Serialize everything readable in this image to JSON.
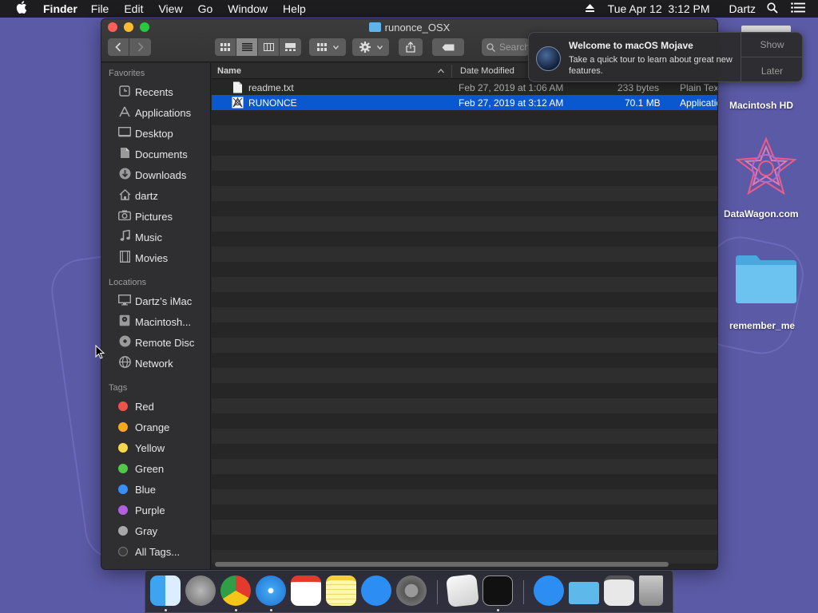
{
  "menubar": {
    "app_name": "Finder",
    "menus": [
      "File",
      "Edit",
      "View",
      "Go",
      "Window",
      "Help"
    ],
    "clock": "Tue Apr 12  3:12 PM",
    "user": "Dartz"
  },
  "window": {
    "title": "runonce_OSX",
    "search_placeholder": "Search"
  },
  "sidebar": {
    "favorites_header": "Favorites",
    "favorites": [
      {
        "label": "Recents",
        "icon": "clock-icon"
      },
      {
        "label": "Applications",
        "icon": "applications-icon"
      },
      {
        "label": "Desktop",
        "icon": "desktop-icon"
      },
      {
        "label": "Documents",
        "icon": "document-icon"
      },
      {
        "label": "Downloads",
        "icon": "download-icon"
      },
      {
        "label": "dartz",
        "icon": "home-icon"
      },
      {
        "label": "Pictures",
        "icon": "camera-icon"
      },
      {
        "label": "Music",
        "icon": "music-note-icon"
      },
      {
        "label": "Movies",
        "icon": "film-icon"
      }
    ],
    "locations_header": "Locations",
    "locations": [
      {
        "label": "Dartz’s iMac",
        "icon": "imac-icon"
      },
      {
        "label": "Macintosh...",
        "icon": "harddisk-icon"
      },
      {
        "label": "Remote Disc",
        "icon": "disc-icon"
      },
      {
        "label": "Network",
        "icon": "globe-icon"
      }
    ],
    "tags_header": "Tags",
    "tags": [
      {
        "label": "Red",
        "color": "#f0524c"
      },
      {
        "label": "Orange",
        "color": "#f5a623"
      },
      {
        "label": "Yellow",
        "color": "#f6d84a"
      },
      {
        "label": "Green",
        "color": "#52c84a"
      },
      {
        "label": "Blue",
        "color": "#3a8ef6"
      },
      {
        "label": "Purple",
        "color": "#b45fe0"
      },
      {
        "label": "Gray",
        "color": "#a8a8a8"
      },
      {
        "label": "All Tags...",
        "color": "#555555"
      }
    ]
  },
  "filelist": {
    "columns": {
      "name": "Name",
      "date": "Date Modified"
    },
    "rows": [
      {
        "name": "readme.txt",
        "date": "Feb 27, 2019 at 1:06 AM",
        "size": "233 bytes",
        "kind": "Plain Text"
      },
      {
        "name": "RUNONCE",
        "date": "Feb 27, 2019 at 3:12 AM",
        "size": "70.1 MB",
        "kind": "Application"
      }
    ]
  },
  "notification": {
    "title": "Welcome to macOS Mojave",
    "body": "Take a quick tour to learn about great new features.",
    "show_label": "Show",
    "later_label": "Later"
  },
  "desktop": {
    "icons": [
      {
        "label": "Macintosh HD"
      },
      {
        "label": "DataWagon.com"
      },
      {
        "label": "remember_me"
      }
    ]
  }
}
